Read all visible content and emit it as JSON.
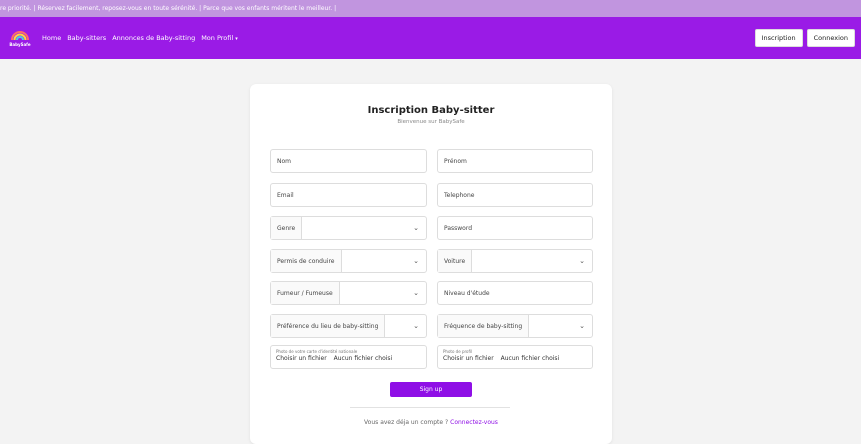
{
  "ticker": {
    "text": "re priorité.   |   Réservez facilement, reposez-vous en toute sérénité.   |   Parce que vos enfants méritent le meilleur.   |"
  },
  "nav": {
    "logo_text": "BabySafe",
    "links": [
      "Home",
      "Baby-sitters",
      "Annonces de Baby-sitting",
      "Mon Profil"
    ],
    "profile_caret": "▾",
    "inscription": "Inscription",
    "connexion": "Connexion"
  },
  "form": {
    "title": "Inscription Baby-sitter",
    "subtitle": "Bienvenue sur BabySafe",
    "nom": "Nom",
    "prenom": "Prénom",
    "email": "Email",
    "telephone": "Telephone",
    "genre": "Genre",
    "password": "Password",
    "permis": "Permis de conduire",
    "voiture": "Voiture",
    "fumeur": "Fumeur / Fumeuse",
    "niveau": "Niveau d'étude",
    "preference": "Préférence du lieu de baby-sitting",
    "frequence": "Fréquence de baby-sitting",
    "chevron": "⌄",
    "cin_label": "Photo de votre carte d'identité nationale",
    "profil_label": "Photo de profil",
    "choose_file": "Choisir un fichier",
    "no_file": "Aucun fichier choisi",
    "signup": "Sign up",
    "have_account": "Vous avez déja un compte ?",
    "connect_link": "Connectez-vous"
  },
  "colors": {
    "nav_bg": "#9a1be6",
    "ticker_bg": "#c195df",
    "accent": "#8f0fe6"
  }
}
